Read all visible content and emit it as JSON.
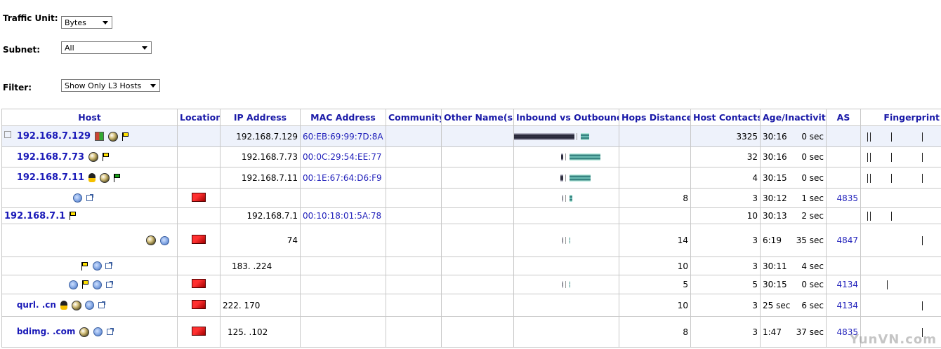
{
  "controls": {
    "traffic_unit": {
      "label": "Traffic Unit:",
      "value": "Bytes"
    },
    "subnet": {
      "label": "Subnet:",
      "value": "All"
    },
    "filter": {
      "label": "Filter:",
      "value": "Show Only L3 Hosts"
    }
  },
  "table": {
    "headers": [
      "Host",
      "Location",
      "IP Address",
      "MAC Address",
      "Community",
      "Other Name(s)",
      "Inbound vs Outbound",
      "Hops Distance",
      "Host Contacts",
      "Age/Inactivity",
      "AS",
      "Fingerprint"
    ],
    "rows": [
      {
        "host": "192.168.7.129",
        "ip": "192.168.7.129",
        "mac": "60:EB:69:99:7D:8A",
        "hops": "",
        "contacts": "3325",
        "age": "30:16",
        "inactivity": "0 sec",
        "as": ""
      },
      {
        "host": "192.168.7.73",
        "ip": "192.168.7.73",
        "mac": "00:0C:29:54:EE:77",
        "hops": "",
        "contacts": "32",
        "age": "30:16",
        "inactivity": "0 sec",
        "as": ""
      },
      {
        "host": "192.168.7.11",
        "ip": "192.168.7.11",
        "mac": "00:1E:67:64:D6:F9",
        "hops": "",
        "contacts": "4",
        "age": "30:15",
        "inactivity": "0 sec",
        "as": ""
      },
      {
        "host": "",
        "ip": "",
        "mac": "",
        "hops": "8",
        "contacts": "3",
        "age": "30:12",
        "inactivity": "1 sec",
        "as": "4835"
      },
      {
        "host": "192.168.7.1",
        "ip": "192.168.7.1",
        "mac": "00:10:18:01:5A:78",
        "hops": "",
        "contacts": "10",
        "age": "30:13",
        "inactivity": "2 sec",
        "as": ""
      },
      {
        "host": "",
        "ip": "74",
        "mac": "",
        "hops": "14",
        "contacts": "3",
        "age": "6:19",
        "inactivity": "35 sec",
        "as": "4847"
      },
      {
        "host": "",
        "ip": "183.  .224",
        "mac": "",
        "hops": "10",
        "contacts": "3",
        "age": "30:11",
        "inactivity": "4 sec",
        "as": ""
      },
      {
        "host": "",
        "ip": "",
        "mac": "",
        "hops": "5",
        "contacts": "5",
        "age": "30:15",
        "inactivity": "0 sec",
        "as": "4134"
      },
      {
        "host": "qurl.      .cn",
        "ip": "222.          170",
        "mac": "",
        "hops": "10",
        "contacts": "3",
        "age": "25 sec",
        "inactivity": "6 sec",
        "as": "4134"
      },
      {
        "host": "bdimg.              .com",
        "ip": "125.         .102",
        "mac": "",
        "hops": "8",
        "contacts": "3",
        "age": "1:47",
        "inactivity": "37 sec",
        "as": "4835"
      }
    ]
  },
  "watermark": "YunVN.com"
}
